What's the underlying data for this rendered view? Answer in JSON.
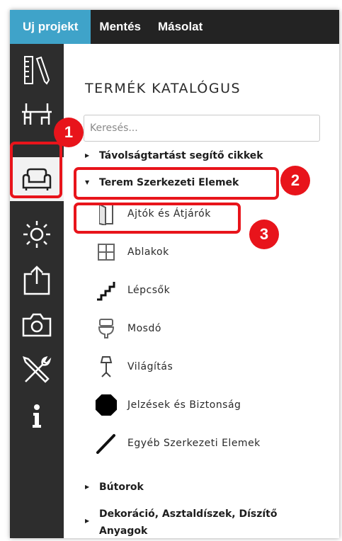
{
  "topbar": {
    "tabs": [
      {
        "label": "Uj projekt",
        "active": true
      },
      {
        "label": "Mentés",
        "active": false
      },
      {
        "label": "Másolat",
        "active": false
      }
    ]
  },
  "sidebar": {
    "items": [
      {
        "icon": "ruler-pencil-icon"
      },
      {
        "icon": "furniture-set-icon"
      },
      {
        "icon": "armchair-icon",
        "active": true
      },
      {
        "icon": "sun-icon"
      },
      {
        "icon": "export-icon"
      },
      {
        "icon": "camera-icon"
      },
      {
        "icon": "tools-icon"
      },
      {
        "icon": "info-icon"
      }
    ]
  },
  "catalog": {
    "title": "TERMÉK KATALÓGUS",
    "search_placeholder": "Keresés...",
    "categories": [
      {
        "label": "Távolságtartást segítő cikkek"
      },
      {
        "label": "Terem Szerkezeti Elemek"
      },
      {
        "label": "Bútorok"
      },
      {
        "label": "Dekoráció, Asztaldíszek, Díszítő Anyagok"
      }
    ],
    "items": [
      {
        "label": "Ajtók és Átjárók",
        "icon": "door-icon"
      },
      {
        "label": "Ablakok",
        "icon": "window-icon"
      },
      {
        "label": "Lépcsők",
        "icon": "stairs-icon"
      },
      {
        "label": "Mosdó",
        "icon": "toilet-icon"
      },
      {
        "label": "Világítás",
        "icon": "lamp-icon"
      },
      {
        "label": "Jelzések és Biztonság",
        "icon": "octagon-sign-icon"
      },
      {
        "label": "Egyéb Szerkezeti Elemek",
        "icon": "brush-stroke-icon"
      }
    ]
  },
  "callouts": [
    "1",
    "2",
    "3"
  ],
  "colors": {
    "accent": "#3fa3c9",
    "highlight": "#e8141b",
    "sidebar": "#2d2d2d",
    "topbar": "#232323"
  }
}
